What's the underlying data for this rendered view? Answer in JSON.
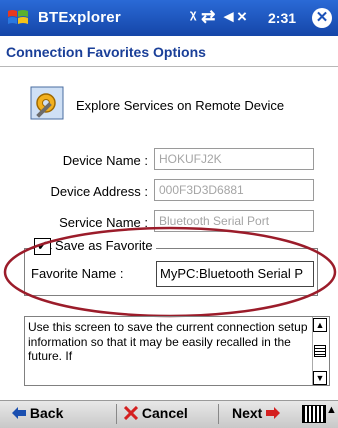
{
  "titlebar": {
    "app_title": "BTExplorer",
    "status_icons": "ᵡ ⇄ ◄×",
    "time": "2:31",
    "close_glyph": "✕"
  },
  "heading": "Connection Favorites Options",
  "service_text": "Explore Services on Remote Device",
  "fields": {
    "device_name_label": "Device Name :",
    "device_name_value": "HOKUFJ2K",
    "device_address_label": "Device Address :",
    "device_address_value": "000F3D3D6881",
    "service_name_label": "Service Name :",
    "service_name_value": "Bluetooth Serial Port"
  },
  "favorite": {
    "checkbox_label": "Save as Favorite",
    "checked_glyph": "✔",
    "name_label": "Favorite Name :",
    "name_value": "MyPC:Bluetooth Serial P"
  },
  "description": "Use this screen to save the current connection setup information so that it may be easily recalled in the future.  If",
  "scroll": {
    "up": "▲",
    "down": "▼"
  },
  "bottom": {
    "back_label": "Back",
    "cancel_label": "Cancel",
    "next_label": "Next",
    "menu_arrow": "▲"
  },
  "colors": {
    "titlebar": "#1c52b8",
    "heading": "#1a3f98",
    "highlight_ellipse": "#9b1c2a",
    "back_arrow": "#1a4fb0",
    "cancel_x": "#d42020",
    "next_arrow": "#d42020"
  }
}
